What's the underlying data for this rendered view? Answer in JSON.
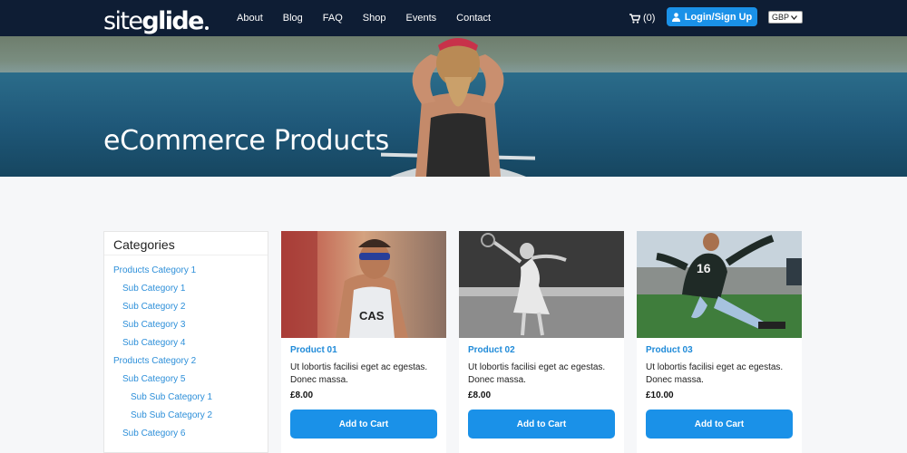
{
  "brand": {
    "logo_light": "site",
    "logo_bold": "glide"
  },
  "nav": {
    "items": [
      {
        "label": "About"
      },
      {
        "label": "Blog"
      },
      {
        "label": "FAQ"
      },
      {
        "label": "Shop"
      },
      {
        "label": "Events"
      },
      {
        "label": "Contact"
      }
    ],
    "cart_count": "(0)",
    "login_label": "Login/Sign Up",
    "currency": "GBP"
  },
  "hero": {
    "title": "eCommerce Products"
  },
  "sidebar": {
    "title": "Categories",
    "items": [
      {
        "label": "Products Category 1",
        "level": 0
      },
      {
        "label": "Sub Category 1",
        "level": 1
      },
      {
        "label": "Sub Category 2",
        "level": 1
      },
      {
        "label": "Sub Category 3",
        "level": 1
      },
      {
        "label": "Sub Category 4",
        "level": 1
      },
      {
        "label": "Products Category 2",
        "level": 0
      },
      {
        "label": "Sub Category 5",
        "level": 1
      },
      {
        "label": "Sub Sub Category 1",
        "level": 2
      },
      {
        "label": "Sub Sub Category 2",
        "level": 2
      },
      {
        "label": "Sub Category 6",
        "level": 1
      }
    ]
  },
  "products": [
    {
      "name": "Product 01",
      "desc": "Ut lobortis facilisi eget ac egestas. Donec massa.",
      "price": "£8.00",
      "button": "Add to Cart"
    },
    {
      "name": "Product 02",
      "desc": "Ut lobortis facilisi eget ac egestas. Donec massa.",
      "price": "£8.00",
      "button": "Add to Cart"
    },
    {
      "name": "Product 03",
      "desc": "Ut lobortis facilisi eget ac egestas. Donec massa.",
      "price": "£10.00",
      "button": "Add to Cart"
    }
  ],
  "colors": {
    "nav_bg": "#0e1d34",
    "accent": "#1a91e8",
    "link": "#2d8fd9"
  }
}
